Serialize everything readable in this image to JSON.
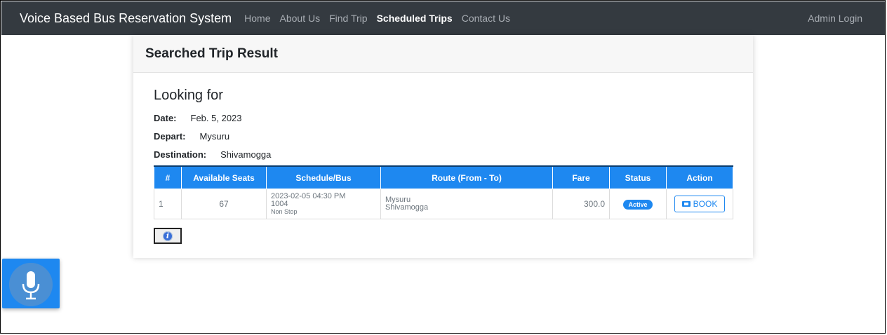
{
  "navbar": {
    "brand": "Voice Based Bus Reservation System",
    "links": [
      "Home",
      "About Us",
      "Find Trip",
      "Scheduled Trips",
      "Contact Us"
    ],
    "active": "Scheduled Trips",
    "right_link": "Admin Login"
  },
  "card": {
    "title": "Searched Trip Result",
    "looking_for": "Looking for",
    "date_label": "Date:",
    "date_value": "Feb. 5, 2023",
    "depart_label": "Depart:",
    "depart_value": "Mysuru",
    "destination_label": "Destination:",
    "destination_value": "Shivamogga"
  },
  "table": {
    "headers": [
      "#",
      "Available Seats",
      "Schedule/Bus",
      "Route (From - To)",
      "Fare",
      "Status",
      "Action"
    ],
    "rows": [
      {
        "num": "1",
        "seats": "67",
        "schedule": "2023-02-05 04:30 PM",
        "bus": "1004",
        "bus_type": "Non Stop",
        "route_from": "Mysuru",
        "route_to": "Shivamogga",
        "fare": "300.0",
        "status": "Active",
        "action": "BOOK"
      }
    ]
  },
  "icons": {
    "info": "info-icon",
    "mic": "microphone-icon",
    "ticket": "ticket-icon"
  },
  "colors": {
    "navbar_bg": "#343a40",
    "accent": "#1e88f0"
  }
}
